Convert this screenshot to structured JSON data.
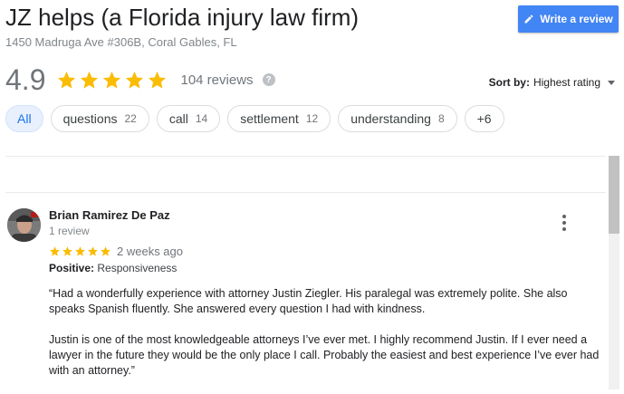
{
  "header": {
    "title": "JZ helps (a Florida injury law firm)",
    "address": "1450 Madruga Ave #306B, Coral Gables, FL",
    "write_review_label": "Write a review",
    "write_review_icon": "pencil-icon"
  },
  "summary": {
    "rating": "4.9",
    "stars": 5,
    "review_count": "104 reviews",
    "help_glyph": "?"
  },
  "sort": {
    "label": "Sort by:",
    "value": "Highest rating"
  },
  "chips": [
    {
      "label": "All",
      "count": ""
    },
    {
      "label": "questions",
      "count": "22"
    },
    {
      "label": "call",
      "count": "14"
    },
    {
      "label": "settlement",
      "count": "12"
    },
    {
      "label": "understanding",
      "count": "8"
    },
    {
      "label": "+6",
      "count": ""
    }
  ],
  "review": {
    "name": "Brian Ramirez De Paz",
    "sub": "1 review",
    "stars": 5,
    "time": "2 weeks ago",
    "positive_label": "Positive:",
    "positive_value": "Responsiveness",
    "paragraph1": "“Had a wonderfully experience with attorney Justin Ziegler. His paralegal was extremely polite.  She also speaks Spanish fluently.  She answered every question I had with kindness.",
    "paragraph2": "Justin is one of the most knowledgeable attorneys I’ve ever met. I highly recommend Justin. If I ever need a lawyer in the future they would be the only place I call.  Probably the easiest and best experience I’ve ever had with an attorney.”"
  },
  "colors": {
    "accent": "#4285f4",
    "star": "#fbbc04",
    "chip_active_bg": "#e8f0fe",
    "chip_active_text": "#1a73e8"
  }
}
